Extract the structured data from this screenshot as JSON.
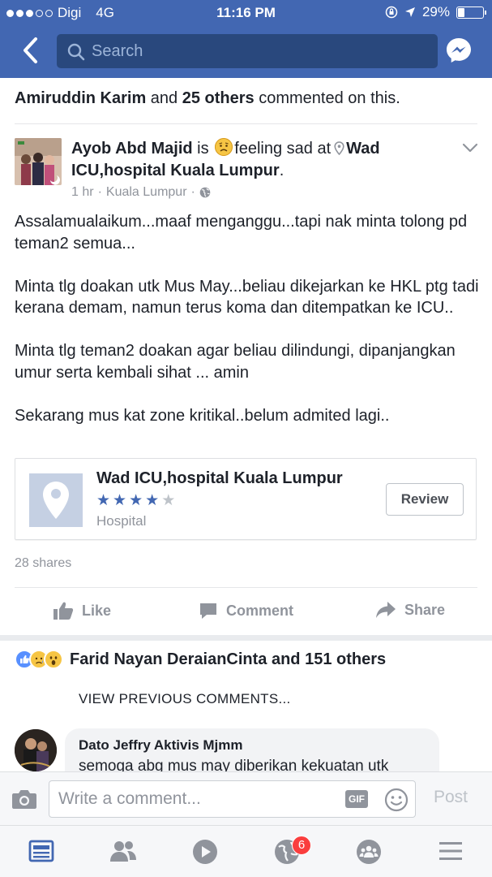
{
  "status_bar": {
    "carrier": "Digi",
    "network": "4G",
    "time": "11:16 PM",
    "battery_percent": "29%",
    "battery_level": 0.29,
    "signal_bars": 3
  },
  "header": {
    "search_placeholder": "Search",
    "back_icon": "chevron-left-icon",
    "messenger_icon": "messenger-icon"
  },
  "activity": {
    "name": "Amiruddin Karim",
    "connector": " and ",
    "others": "25 others",
    "suffix": " commented on this."
  },
  "post": {
    "author": "Ayob Abd Majid",
    "is_text": " is ",
    "feeling_text": "feeling sad at",
    "location": "Wad ICU,hospital Kuala Lumpur",
    "period": ".",
    "time_ago": "1 hr",
    "meta_sep": "·",
    "place": "Kuala Lumpur",
    "paragraphs": [
      "Assalamualaikum...maaf menganggu...tapi nak minta tolong pd teman2 semua...",
      "Minta tlg doakan utk Mus May...beliau dikejarkan ke HKL ptg tadi kerana demam, namun terus koma dan ditempatkan ke ICU..",
      "Minta tlg teman2 doakan agar beliau dilindungi, dipanjangkan umur serta kembali sihat ... amin",
      "Sekarang mus kat zone kritikal..belum admited lagi.."
    ]
  },
  "place_card": {
    "name": "Wad ICU,hospital Kuala Lumpur",
    "rating": 4,
    "rating_max": 5,
    "category": "Hospital",
    "review_label": "Review"
  },
  "post_stats": {
    "shares": "28 shares"
  },
  "actions": {
    "like": "Like",
    "comment": "Comment",
    "share": "Share"
  },
  "reactions": {
    "summary": "Farid Nayan DeraianCinta and 151 others",
    "icons": [
      "like-reaction-icon",
      "sad-reaction-icon",
      "wow-reaction-icon"
    ]
  },
  "comments": {
    "view_previous": "VIEW PREVIOUS COMMENTS...",
    "items": [
      {
        "author": "Dato Jeffry Aktivis Mjmm",
        "text": "semoga abg mus may diberikan kekuatan utk"
      }
    ]
  },
  "composer": {
    "placeholder": "Write a comment...",
    "gif_label": "GIF",
    "post_label": "Post"
  },
  "tab_bar": {
    "tabs": [
      "news-feed-icon",
      "friends-icon",
      "video-icon",
      "notifications-icon",
      "groups-icon",
      "menu-icon"
    ],
    "notifications_badge": "6"
  },
  "colors": {
    "brand_blue": "#4267b2",
    "search_bg": "#29487d",
    "badge_red": "#fa3e3e",
    "muted_text": "#90949c"
  }
}
